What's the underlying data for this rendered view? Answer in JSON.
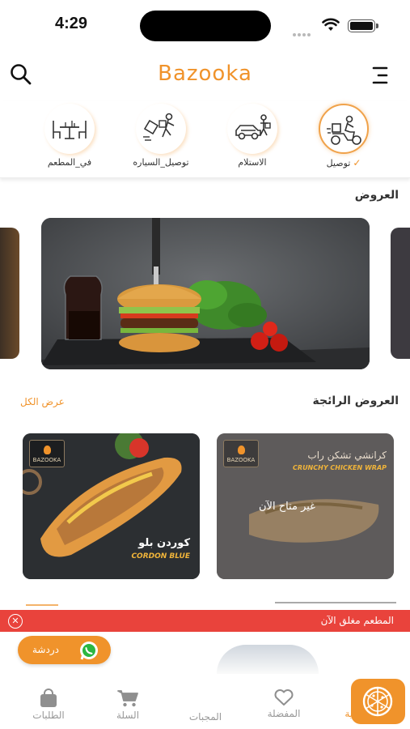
{
  "status_bar": {
    "time": "4:29"
  },
  "header": {
    "brand": "Bazooka",
    "search_icon": "search-icon",
    "menu_icon": "hamburger-menu-icon"
  },
  "services": [
    {
      "label": "توصيل",
      "icon": "delivery-scooter-icon",
      "active": true
    },
    {
      "label": "الاستلام",
      "icon": "pickup-car-icon",
      "active": false
    },
    {
      "label": "توصيل_السياره",
      "icon": "car-delivery-icon",
      "active": false
    },
    {
      "label": "في_المطعم",
      "icon": "dine-in-table-icon",
      "active": false
    }
  ],
  "offers": {
    "title": "العروض"
  },
  "popular": {
    "title": "العروض الرائجة",
    "view_all": "عرض الكل",
    "cards": [
      {
        "logo": "BAZOOKA",
        "subtitle_ar": "كوردن بلو",
        "subtitle_en": "CORDON BLUE"
      },
      {
        "logo": "BAZOOKA",
        "subtitle_ar": "كرانشي تشكن راب",
        "subtitle_en": "CRUNCHY CHICKEN WRAP",
        "status": "غير متاح الآن"
      }
    ]
  },
  "closed_banner": {
    "text": "المطعم مغلق الآن"
  },
  "chat": {
    "label": "دردشة",
    "icon": "whatsapp-icon"
  },
  "colors": {
    "accent": "#f0932b",
    "alert": "#e9433c"
  },
  "bottom_nav": [
    {
      "label": "الرئيسية",
      "icon": "home-icon",
      "active": true
    },
    {
      "label": "المفضلة",
      "icon": "heart-icon",
      "active": false
    },
    {
      "label": "المجبات",
      "icon": "pizza-icon",
      "active": false
    },
    {
      "label": "السلة",
      "icon": "cart-icon",
      "active": false
    },
    {
      "label": "الطلبات",
      "icon": "shopping-bag-icon",
      "active": false
    }
  ]
}
